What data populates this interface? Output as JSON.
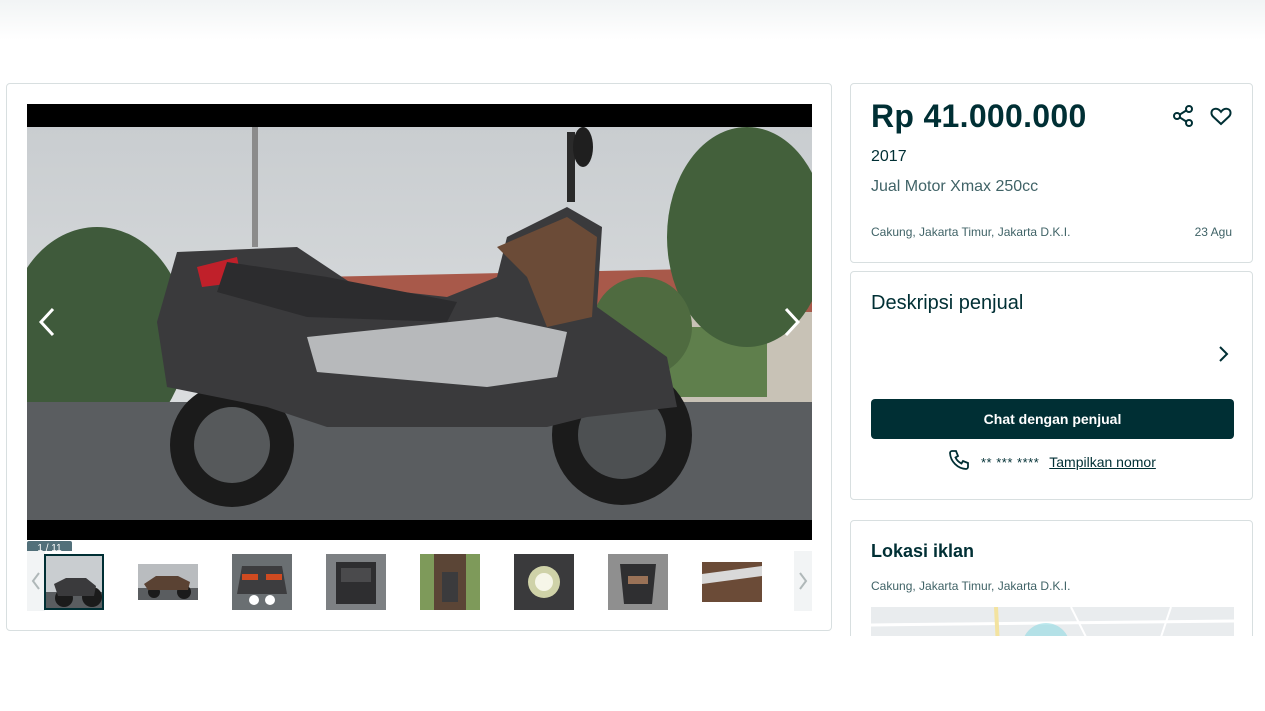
{
  "gallery": {
    "counter": "1 / 11",
    "thumbnail_count": 8,
    "main_image_icon": "motorcycle-photo"
  },
  "listing": {
    "price": "Rp 41.000.000",
    "year": "2017",
    "title": "Jual Motor Xmax 250cc",
    "location": "Cakung, Jakarta Timur, Jakarta D.K.I.",
    "date": "23 Agu"
  },
  "seller": {
    "heading": "Deskripsi penjual",
    "chat_label": "Chat dengan penjual",
    "masked_phone": "** *** ****",
    "show_number_label": "Tampilkan nomor"
  },
  "location_card": {
    "heading": "Lokasi iklan",
    "address": "Cakung, Jakarta Timur, Jakarta D.K.I."
  },
  "colors": {
    "primary": "#002f34",
    "secondary_text": "#406367",
    "border": "#d8dfe0"
  }
}
